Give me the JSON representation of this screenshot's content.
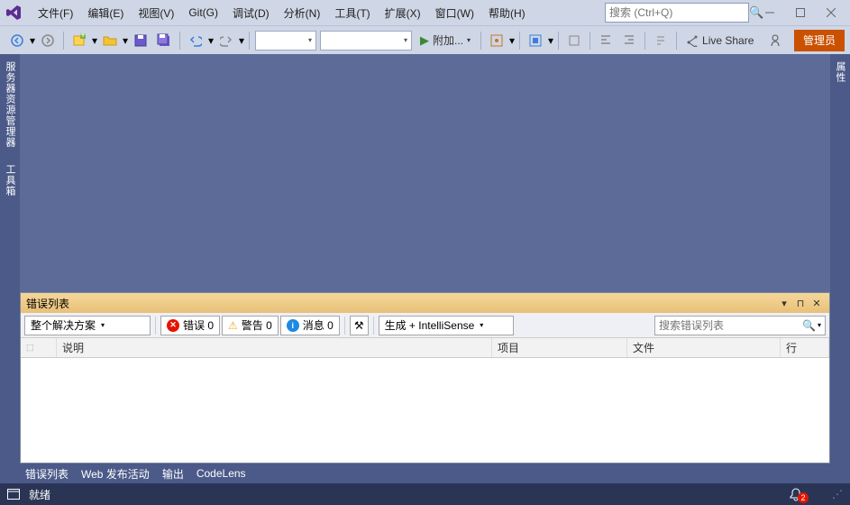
{
  "menu": {
    "file": "文件(F)",
    "edit": "编辑(E)",
    "view": "视图(V)",
    "git": "Git(G)",
    "debug": "调试(D)",
    "analyze": "分析(N)",
    "tools": "工具(T)",
    "extensions": "扩展(X)",
    "window": "窗口(W)",
    "help": "帮助(H)"
  },
  "search": {
    "placeholder": "搜索 (Ctrl+Q)"
  },
  "toolbar": {
    "attach_label": "附加...",
    "liveshare_label": "Live Share",
    "admin_label": "管理员"
  },
  "side": {
    "left1": "服务器资源管理器",
    "left2": "工具箱",
    "right1": "属性"
  },
  "panel": {
    "title": "错误列表",
    "scope": "整个解决方案",
    "errors_label": "错误 0",
    "warnings_label": "警告 0",
    "messages_label": "消息 0",
    "build_scope": "生成 + IntelliSense",
    "search_placeholder": "搜索错误列表",
    "col_desc": "说明",
    "col_proj": "项目",
    "col_file": "文件",
    "col_line": "行"
  },
  "tabs": {
    "errorlist": "错误列表",
    "webpub": "Web 发布活动",
    "output": "输出",
    "codelens": "CodeLens"
  },
  "status": {
    "ready": "就绪",
    "notifications": "2"
  }
}
